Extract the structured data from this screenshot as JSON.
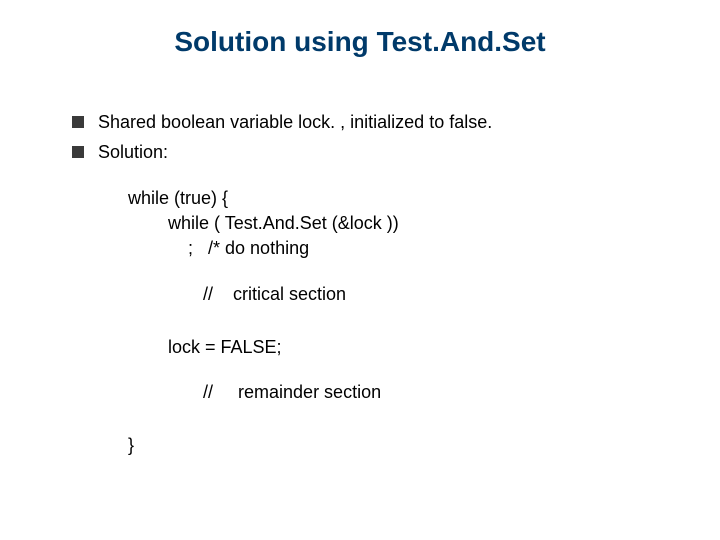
{
  "title": "Solution using Test.And.Set",
  "bullets": [
    "Shared boolean variable lock. , initialized to false.",
    "Solution:"
  ],
  "code": {
    "l1": "while (true) {",
    "l2": "        while ( Test.And.Set (&lock ))",
    "l3": "            ;   /* do nothing",
    "l4": "               //    critical section",
    "l5": "        lock = FALSE;",
    "l6": "               //     remainder section",
    "l7": "}"
  }
}
